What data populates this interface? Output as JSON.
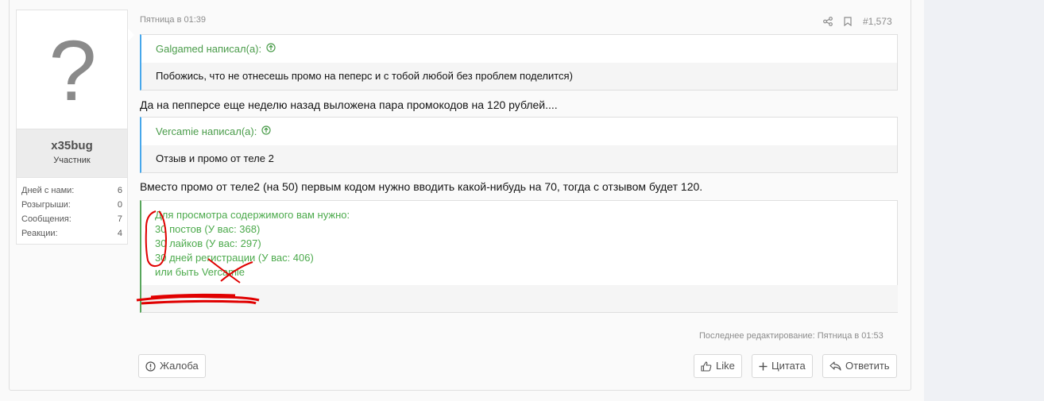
{
  "user": {
    "avatar_glyph": "?",
    "name": "x35bug",
    "title": "Участник",
    "stats": [
      {
        "label": "Дней с нами:",
        "value": "6"
      },
      {
        "label": "Розыгрыши:",
        "value": "0"
      },
      {
        "label": "Сообщения:",
        "value": "7"
      },
      {
        "label": "Реакции:",
        "value": "4"
      }
    ]
  },
  "post": {
    "date": "Пятница в 01:39",
    "number": "#1,573",
    "quote1": {
      "author": "Galgamed написал(а):",
      "text": "Побожись, что не отнесешь промо на пеперс и с тобой любой без проблем поделится)"
    },
    "text1": "Да на пепперсе еще неделю назад выложена пара промокодов на 120 рублей....",
    "quote2": {
      "author": "Vercamie написал(а):",
      "text": "Отзыв и промо от теле 2"
    },
    "text2": "Вместо промо от теле2 (на 50) первым кодом нужно вводить какой-нибудь на 70, тогда с отзывом будет 120.",
    "hidden": {
      "line1": "Для просмотра содержимого вам нужно:",
      "line2": "30 постов (У вас: 368)",
      "line3": "30 лайков (У вас: 297)",
      "line4": "30 дней регистрации (У вас: 406)",
      "line5": "или быть Vercamie"
    },
    "edited": "Последнее редактирование: Пятница в 01:53"
  },
  "buttons": {
    "report": "Жалоба",
    "like": "Like",
    "quote": "Цитата",
    "reply": "Ответить"
  },
  "colors": {
    "quote_border": "#47a7eb",
    "hidden_text": "#4caa4c",
    "annotation": "#e00000"
  }
}
